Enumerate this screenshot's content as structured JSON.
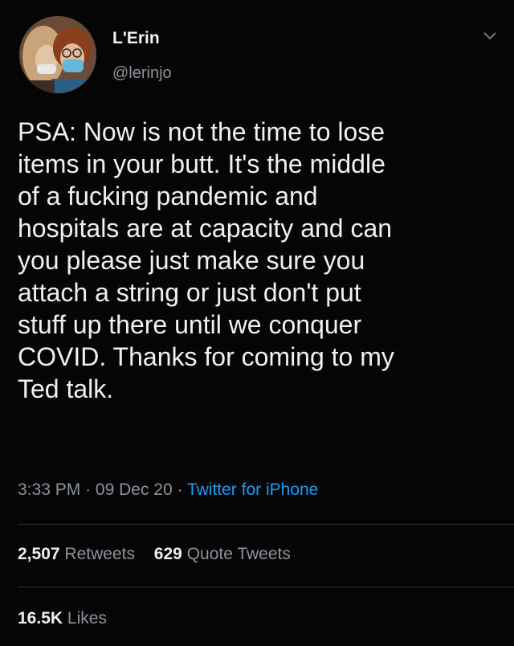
{
  "user": {
    "display_name": "L'Erin",
    "handle": "@lerinjo",
    "avatar_icon": "profile-photo"
  },
  "tweet": {
    "text": "PSA: Now is not the time to lose\nitems in your butt. It's the middle\nof a fucking pandemic and\nhospitals are at capacity and can\nyou please just make sure you\nattach a string or just don't put\nstuff up there until we conquer\nCOVID. Thanks for coming to my\nTed talk.",
    "time": "3:33 PM",
    "sep1": "·",
    "date": "09 Dec 20",
    "sep2": "·",
    "source": "Twitter for iPhone"
  },
  "stats": {
    "retweets_count": "2,507",
    "retweets_label": "Retweets",
    "quotes_count": "629",
    "quotes_label": "Quote Tweets",
    "likes_count": "16.5K",
    "likes_label": "Likes"
  },
  "colors": {
    "background": "#050505",
    "text": "#f0f0f0",
    "secondary": "#8b949c",
    "link": "#1d9bf0",
    "divider": "#2f3336"
  }
}
